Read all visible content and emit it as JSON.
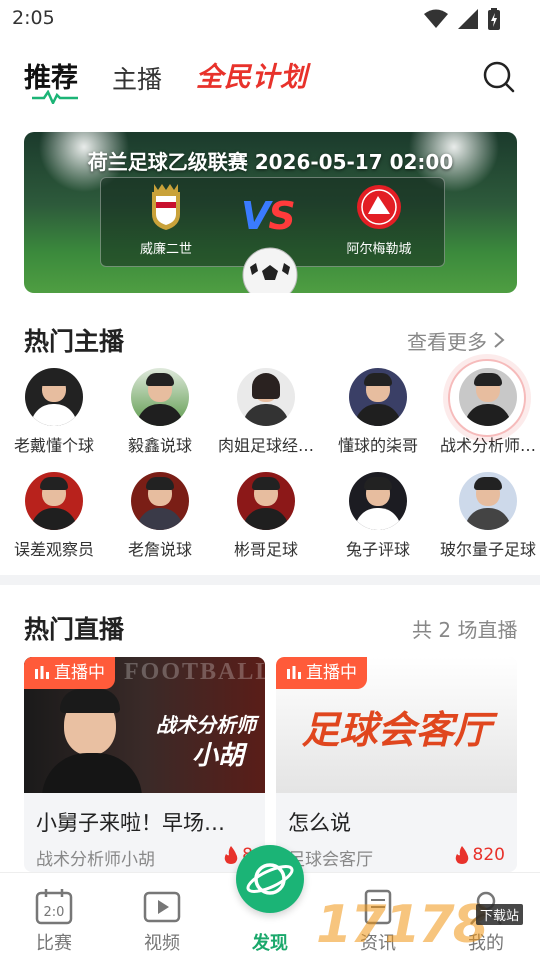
{
  "status": {
    "time": "2:05"
  },
  "top_nav": {
    "tab_recommend": "推荐",
    "tab_anchor": "主播",
    "tab_plan": "全民计划"
  },
  "banner": {
    "title": "荷兰足球乙级联赛  2026-05-17 02:00",
    "home_team": "威廉二世",
    "away_team": "阿尔梅勒城",
    "vs": "VS"
  },
  "hot_anchors": {
    "title": "热门主播",
    "more": "查看更多",
    "items": [
      {
        "name": "老戴懂个球"
      },
      {
        "name": "毅鑫说球"
      },
      {
        "name": "肉姐足球经…"
      },
      {
        "name": "懂球的柒哥"
      },
      {
        "name": "战术分析师…"
      },
      {
        "name": "误差观察员"
      },
      {
        "name": "老詹说球"
      },
      {
        "name": "彬哥足球"
      },
      {
        "name": "兔子评球"
      },
      {
        "name": "玻尔量子足球"
      }
    ]
  },
  "hot_live": {
    "title": "热门直播",
    "count_text": "共 2 场直播",
    "cards": [
      {
        "badge": "直播中",
        "thumb_text_1": "FOOTBALL",
        "thumb_text_2": "战术分析师",
        "thumb_text_3": "小胡",
        "title": "小舅子来啦！早场…",
        "anchor": "战术分析师小胡",
        "heat": "8"
      },
      {
        "badge": "直播中",
        "thumb_text_1": "足球会客厅",
        "title": "怎么说",
        "anchor": "足球会客厅",
        "heat": "820"
      }
    ]
  },
  "bottom_nav": {
    "items": [
      {
        "label": "比赛"
      },
      {
        "label": "视频"
      },
      {
        "label": "发现"
      },
      {
        "label": "资讯"
      },
      {
        "label": "我的"
      }
    ]
  },
  "watermark": {
    "text": "17178",
    "tag": "下载站"
  },
  "colors": {
    "brand_green": "#1bb476",
    "live_red": "#ff5b3a",
    "plan_red": "#e8322b"
  }
}
